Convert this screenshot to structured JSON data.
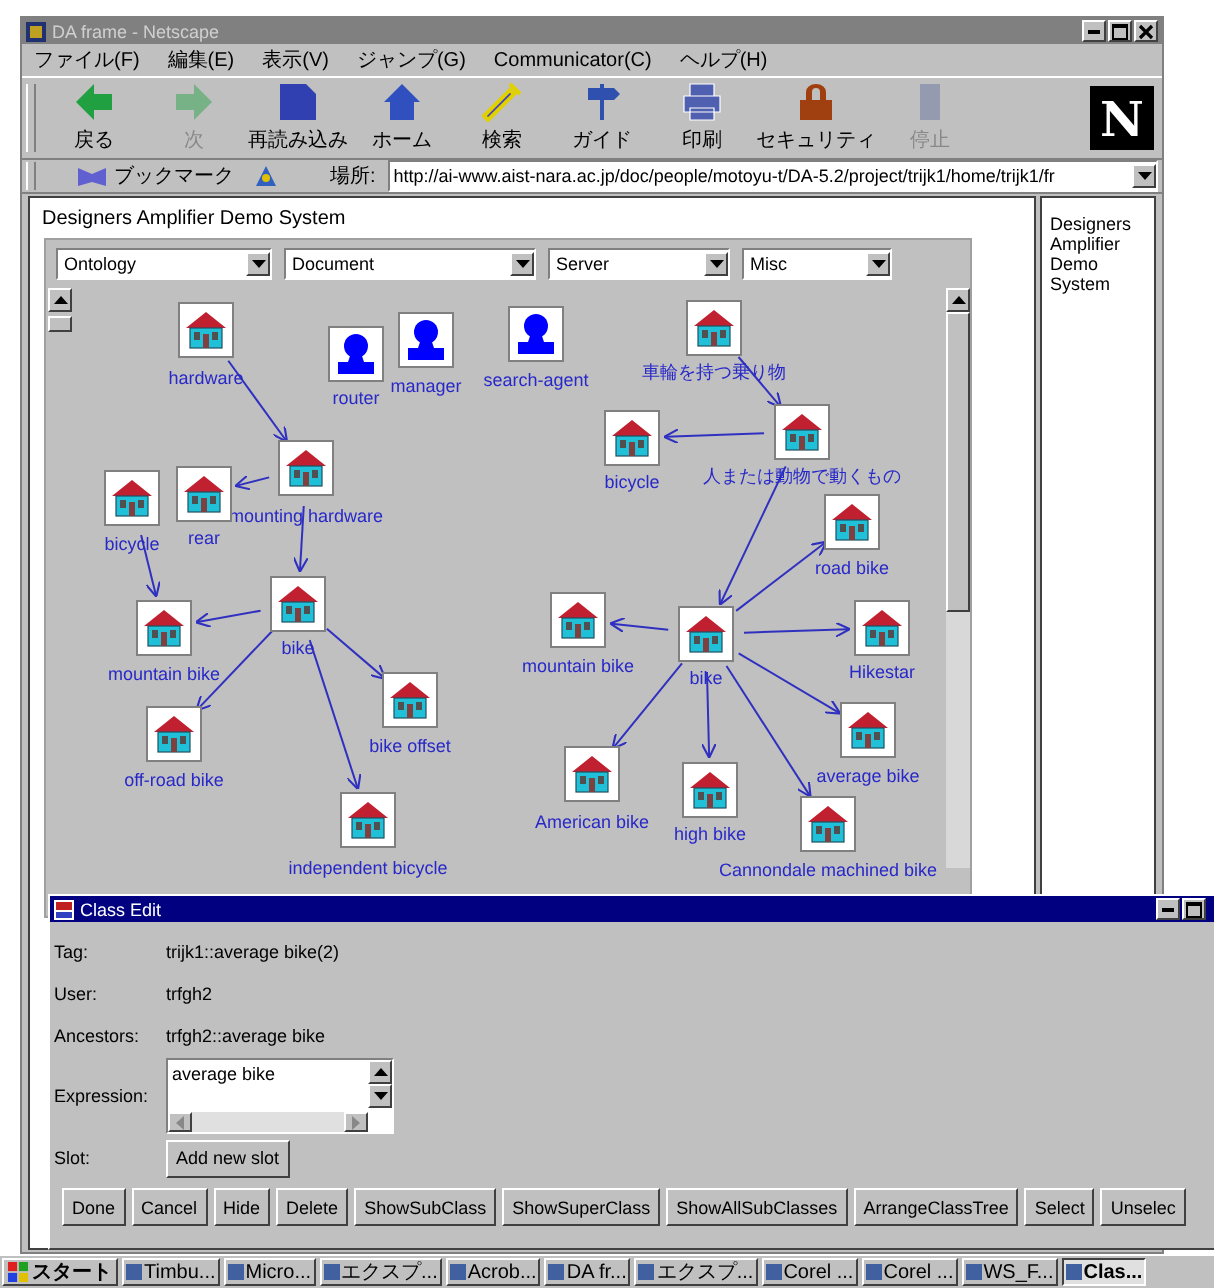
{
  "window": {
    "title": "DA frame - Netscape"
  },
  "menu": [
    "ファイル(F)",
    "編集(E)",
    "表示(V)",
    "ジャンプ(G)",
    "Communicator(C)",
    "ヘルプ(H)"
  ],
  "toolbar": [
    {
      "label": "戻る",
      "disabled": false
    },
    {
      "label": "次",
      "disabled": true
    },
    {
      "label": "再読み込み",
      "disabled": false
    },
    {
      "label": "ホーム",
      "disabled": false
    },
    {
      "label": "検索",
      "disabled": false
    },
    {
      "label": "ガイド",
      "disabled": false
    },
    {
      "label": "印刷",
      "disabled": false
    },
    {
      "label": "セキュリティ",
      "disabled": false
    },
    {
      "label": "停止",
      "disabled": true
    }
  ],
  "logo": "N",
  "location_bar": {
    "bookmarks": "ブックマーク",
    "label": "場所:",
    "url": "http://ai-www.aist-nara.ac.jp/doc/people/motoyu-t/DA-5.2/project/trijk1/home/trijk1/fr"
  },
  "main_frame": {
    "heading": "Designers Amplifier Demo System",
    "dropdowns": [
      "Ontology",
      "Document",
      "Server",
      "Misc"
    ],
    "nodes": [
      {
        "label": "hardware",
        "kind": "class"
      },
      {
        "label": "router",
        "kind": "agent"
      },
      {
        "label": "manager",
        "kind": "agent"
      },
      {
        "label": "search-agent",
        "kind": "agent"
      },
      {
        "label": "mounting hardware",
        "kind": "class"
      },
      {
        "label": "bicycle",
        "kind": "class"
      },
      {
        "label": "rear",
        "kind": "class"
      },
      {
        "label": "bike",
        "kind": "class"
      },
      {
        "label": "mountain bike",
        "kind": "class"
      },
      {
        "label": "bike offset",
        "kind": "class"
      },
      {
        "label": "off-road bike",
        "kind": "class"
      },
      {
        "label": "independent bicycle",
        "kind": "class"
      },
      {
        "label": "車輪を持つ乗り物",
        "kind": "class"
      },
      {
        "label": "bicycle",
        "kind": "class"
      },
      {
        "label": "人または動物で動くもの",
        "kind": "class"
      },
      {
        "label": "road bike",
        "kind": "class"
      },
      {
        "label": "mountain bike",
        "kind": "class"
      },
      {
        "label": "bike",
        "kind": "class"
      },
      {
        "label": "Hikestar",
        "kind": "class"
      },
      {
        "label": "average bike",
        "kind": "class"
      },
      {
        "label": "American bike",
        "kind": "class"
      },
      {
        "label": "high bike",
        "kind": "class"
      },
      {
        "label": "Cannondale machined bike",
        "kind": "class"
      }
    ]
  },
  "side_frame": {
    "text": "Designers Amplifier Demo System"
  },
  "class_edit": {
    "title": "Class Edit",
    "fields": [
      {
        "label": "Tag:",
        "value": "trijk1::average bike(2)"
      },
      {
        "label": "User:",
        "value": "trfgh2"
      },
      {
        "label": "Ancestors:",
        "value": "trfgh2::average bike"
      }
    ],
    "expression": {
      "label": "Expression:",
      "value": "average bike"
    },
    "slot": {
      "label": "Slot:",
      "button": "Add new slot"
    },
    "buttons": [
      "Done",
      "Cancel",
      "Hide",
      "Delete",
      "ShowSubClass",
      "ShowSuperClass",
      "ShowAllSubClasses",
      "ArrangeClassTree",
      "Select",
      "Unselec"
    ]
  },
  "taskbar": {
    "start": "スタート",
    "items": [
      {
        "label": "Timbu...",
        "selected": false
      },
      {
        "label": "Micro...",
        "selected": false
      },
      {
        "label": "エクスプ...",
        "selected": false
      },
      {
        "label": "Acrob...",
        "selected": false
      },
      {
        "label": "DA fr...",
        "selected": false
      },
      {
        "label": "エクスプ...",
        "selected": false
      },
      {
        "label": "Corel ...",
        "selected": false
      },
      {
        "label": "Corel ...",
        "selected": false
      },
      {
        "label": "WS_F...",
        "selected": false
      },
      {
        "label": "Clas...",
        "selected": true
      }
    ]
  }
}
